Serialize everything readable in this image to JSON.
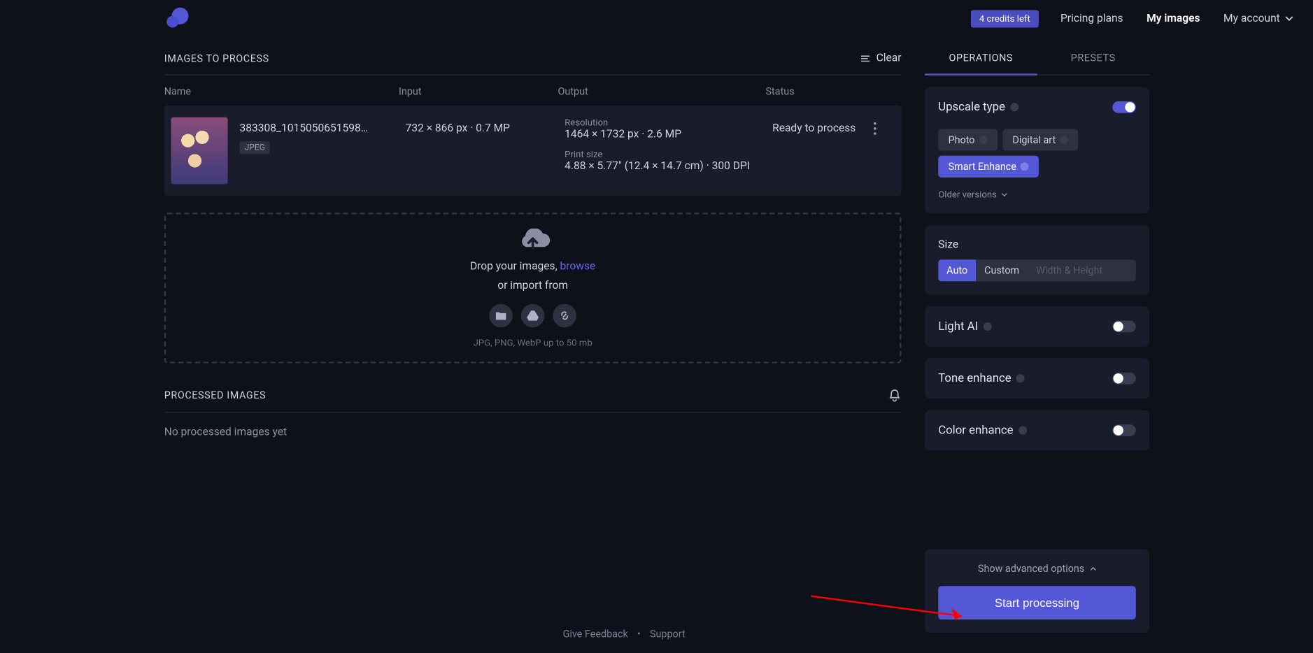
{
  "header": {
    "credits_badge": "4 credits left",
    "nav_pricing": "Pricing plans",
    "nav_my_images": "My images",
    "nav_my_account": "My account"
  },
  "left": {
    "section_title": "IMAGES TO PROCESS",
    "clear": "Clear",
    "columns": {
      "name": "Name",
      "input": "Input",
      "output": "Output",
      "status": "Status"
    },
    "row": {
      "filename": "383308_10150506515987...",
      "filetype": "JPEG",
      "input": "732 × 866 px · 0.7 MP",
      "out_res_label": "Resolution",
      "out_res": "1464 × 1732 px · 2.6 MP",
      "out_print_label": "Print size",
      "out_print": "4.88 × 5.77\" (12.4 × 14.7 cm) · 300 DPI",
      "status": "Ready to process"
    },
    "dropzone": {
      "text_prefix": "Drop your images, ",
      "browse": "browse",
      "text_sub": "or import from",
      "hint": "JPG, PNG, WebP up to 50 mb"
    },
    "processed_title": "PROCESSED IMAGES",
    "no_processed": "No processed images yet"
  },
  "right": {
    "tab_ops": "OPERATIONS",
    "tab_presets": "PRESETS",
    "upscale_type": "Upscale type",
    "chip_photo": "Photo",
    "chip_digital": "Digital art",
    "chip_smart": "Smart Enhance",
    "older_versions": "Older versions",
    "size_label": "Size",
    "seg_auto": "Auto",
    "seg_custom": "Custom",
    "seg_wh": "Width & Height",
    "light_ai": "Light AI",
    "tone": "Tone enhance",
    "color": "Color enhance",
    "advanced": "Show advanced options",
    "start": "Start processing"
  },
  "footer": {
    "feedback": "Give Feedback",
    "support": "Support"
  }
}
